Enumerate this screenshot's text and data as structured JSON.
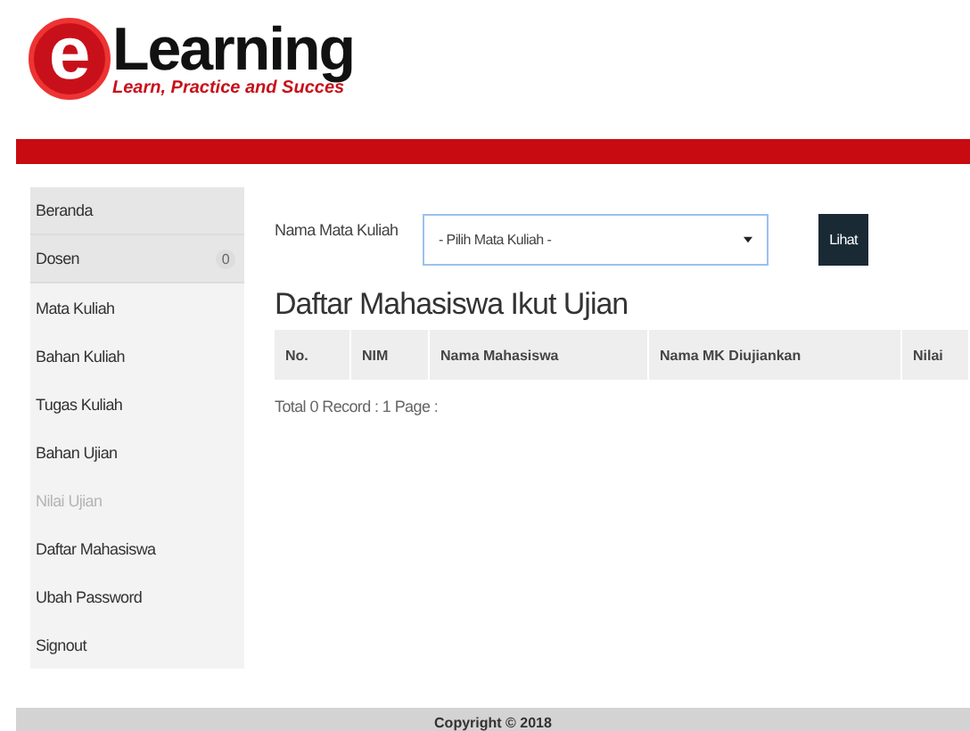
{
  "logo": {
    "letter": "e",
    "name": "Learning",
    "tagline": "Learn, Practice and Succes"
  },
  "sidebar": {
    "items": [
      {
        "label": "Beranda",
        "selected": true,
        "disabled": false
      },
      {
        "label": "Dosen",
        "selected": true,
        "disabled": false,
        "badge": "0"
      },
      {
        "label": "Mata Kuliah",
        "selected": false,
        "disabled": false
      },
      {
        "label": "Bahan Kuliah",
        "selected": false,
        "disabled": false
      },
      {
        "label": "Tugas Kuliah",
        "selected": false,
        "disabled": false
      },
      {
        "label": "Bahan Ujian",
        "selected": false,
        "disabled": false
      },
      {
        "label": "Nilai Ujian",
        "selected": false,
        "disabled": true
      },
      {
        "label": "Daftar Mahasiswa",
        "selected": false,
        "disabled": false
      },
      {
        "label": "Ubah Password",
        "selected": false,
        "disabled": false
      },
      {
        "label": "Signout",
        "selected": false,
        "disabled": false
      }
    ]
  },
  "form": {
    "label": "Nama Mata Kuliah",
    "select_value": "- Pilih Mata Kuliah -",
    "button": "Lihat"
  },
  "heading": "Daftar Mahasiswa Ikut Ujian",
  "table": {
    "columns": [
      "No.",
      "NIM",
      "Nama Mahasiswa",
      "Nama MK Diujiankan",
      "Nilai"
    ]
  },
  "summary": "Total 0 Record : 1 Page :",
  "footer": "Copyright © 2018"
}
